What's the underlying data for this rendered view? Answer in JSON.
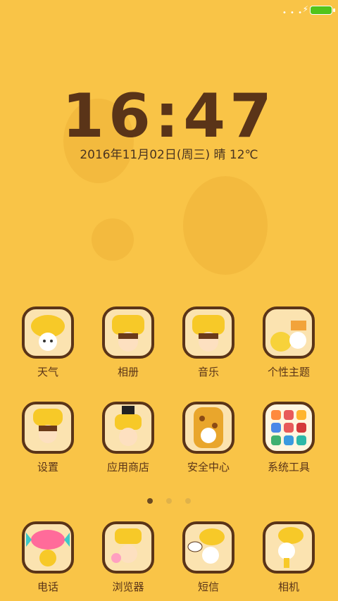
{
  "status": {
    "signal_dots": "• • •",
    "charging_icon": "⚡"
  },
  "lock": {
    "time": "16:47",
    "date_weather": "2016年11月02日(周三)  晴 12℃"
  },
  "apps": [
    {
      "label": "天气",
      "icon": "weather-giraffe-icon"
    },
    {
      "label": "相册",
      "icon": "gallery-giraffe-icon"
    },
    {
      "label": "音乐",
      "icon": "music-giraffe-icon"
    },
    {
      "label": "个性主题",
      "icon": "themes-giraffe-icon"
    },
    {
      "label": "设置",
      "icon": "settings-giraffe-icon"
    },
    {
      "label": "应用商店",
      "icon": "app-store-giraffe-icon"
    },
    {
      "label": "安全中心",
      "icon": "security-giraffe-icon"
    },
    {
      "label": "系统工具",
      "icon": "system-tools-icon"
    }
  ],
  "dock": [
    {
      "label": "电话",
      "icon": "phone-candy-icon"
    },
    {
      "label": "浏览器",
      "icon": "browser-giraffe-icon"
    },
    {
      "label": "短信",
      "icon": "messages-giraffe-icon"
    },
    {
      "label": "相机",
      "icon": "camera-giraffe-icon"
    }
  ],
  "pager": {
    "pages": 3,
    "active": 1
  }
}
